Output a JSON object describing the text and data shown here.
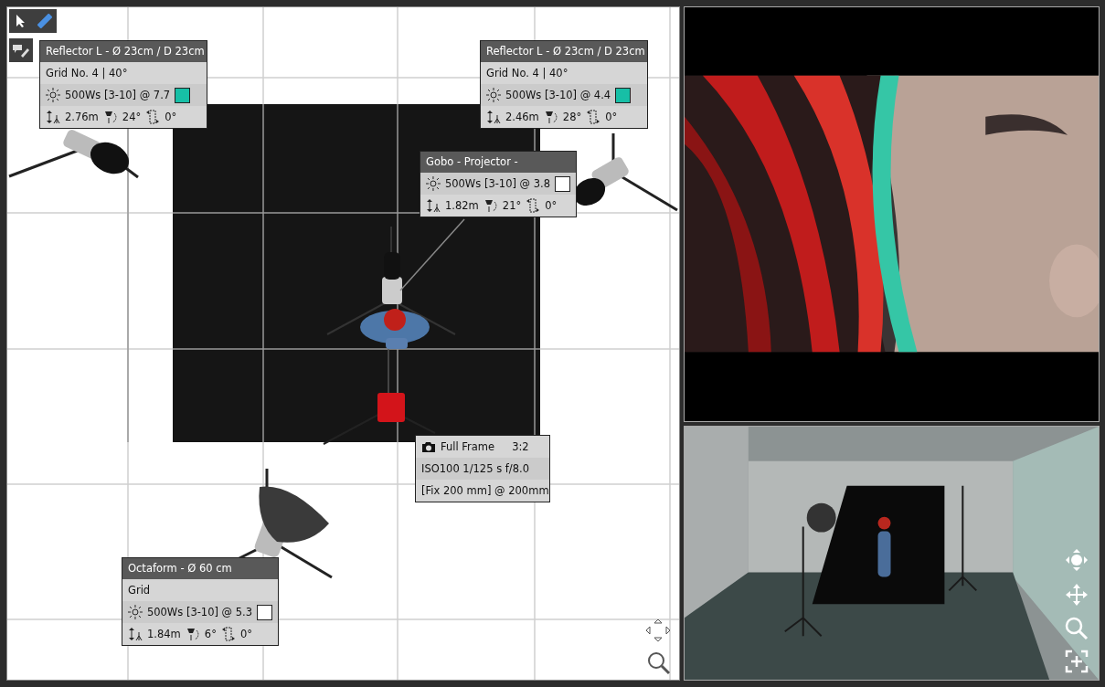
{
  "lights": [
    {
      "title": "Reflector L - Ø 23cm / D 23cm",
      "modifier": "Grid No. 4 | 40°",
      "power": "500Ws [3-10] @ 7.7",
      "color": "#17bfa6",
      "height": "2.76m",
      "tilt": "24°",
      "rotation": "0°"
    },
    {
      "title": "Reflector L - Ø 23cm / D 23cm",
      "modifier": "Grid No. 4 | 40°",
      "power": "500Ws [3-10] @ 4.4",
      "color": "#17bfa6",
      "height": "2.46m",
      "tilt": "28°",
      "rotation": "0°"
    },
    {
      "title": "Gobo - Projector -",
      "power": "500Ws [3-10] @ 3.8",
      "color": "#ffffff",
      "height": "1.82m",
      "tilt": "21°",
      "rotation": "0°"
    },
    {
      "title": "Octaform - Ø 60 cm",
      "modifier": "Grid",
      "power": "500Ws [3-10] @ 5.3",
      "color": "#ffffff",
      "height": "1.84m",
      "tilt": "6°",
      "rotation": "0°"
    }
  ],
  "camera": {
    "sensor": "Full Frame",
    "ratio": "3:2",
    "exposure": "ISO100  1/125 s f/8.0",
    "lens": "[Fix 200 mm] @ 200mm"
  }
}
